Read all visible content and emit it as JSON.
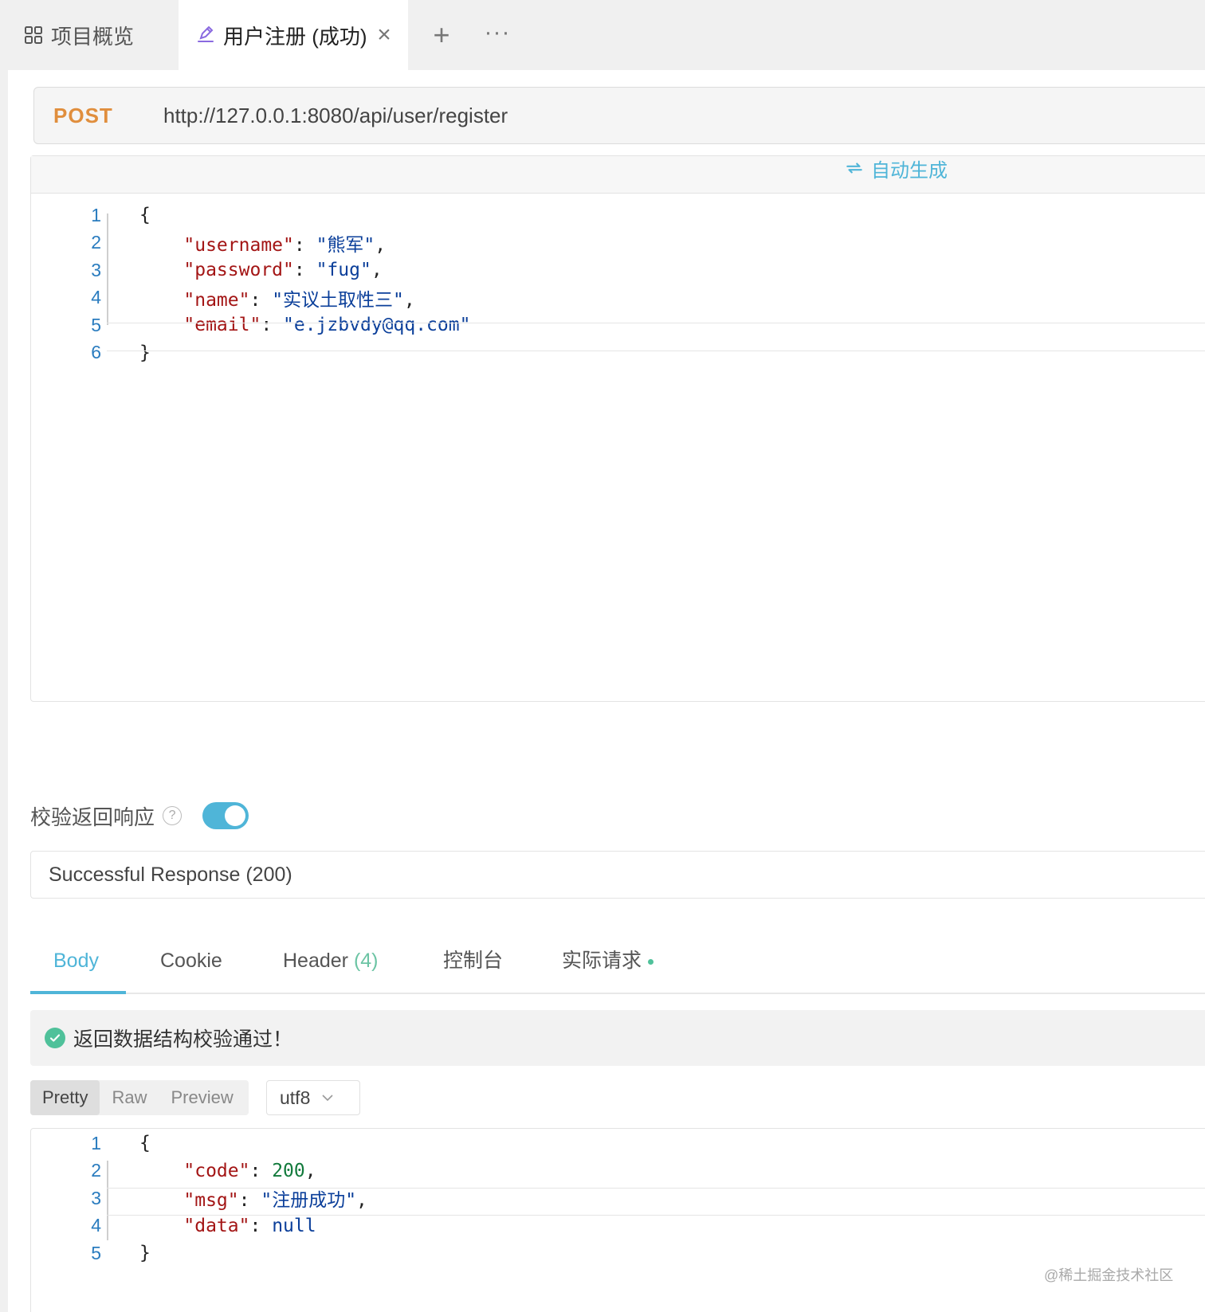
{
  "tabs": {
    "overview_label": "项目概览",
    "active_label": "用户注册 (成功)"
  },
  "request": {
    "method": "POST",
    "url": "http://127.0.0.1:8080/api/user/register",
    "auto_generate_label": "自动生成",
    "body_lines": [
      {
        "no": "1",
        "parts": [
          {
            "t": "p",
            "v": "{"
          }
        ]
      },
      {
        "no": "2",
        "parts": [
          {
            "t": "p",
            "v": "    "
          },
          {
            "t": "k",
            "v": "\"username\""
          },
          {
            "t": "p",
            "v": ": "
          },
          {
            "t": "s",
            "v": "\"熊军\""
          },
          {
            "t": "p",
            "v": ","
          }
        ]
      },
      {
        "no": "3",
        "parts": [
          {
            "t": "p",
            "v": "    "
          },
          {
            "t": "k",
            "v": "\"password\""
          },
          {
            "t": "p",
            "v": ": "
          },
          {
            "t": "s",
            "v": "\"fug\""
          },
          {
            "t": "p",
            "v": ","
          }
        ]
      },
      {
        "no": "4",
        "parts": [
          {
            "t": "p",
            "v": "    "
          },
          {
            "t": "k",
            "v": "\"name\""
          },
          {
            "t": "p",
            "v": ": "
          },
          {
            "t": "s",
            "v": "\"实议土取性三\""
          },
          {
            "t": "p",
            "v": ","
          }
        ]
      },
      {
        "no": "5",
        "parts": [
          {
            "t": "p",
            "v": "    "
          },
          {
            "t": "k",
            "v": "\"email\""
          },
          {
            "t": "p",
            "v": ": "
          },
          {
            "t": "s",
            "v": "\"e.jzbvdy@qq.com\""
          }
        ]
      },
      {
        "no": "6",
        "parts": [
          {
            "t": "p",
            "v": "}"
          }
        ]
      }
    ]
  },
  "validate": {
    "label": "校验返回响应",
    "enabled": true
  },
  "response": {
    "selected": "Successful Response (200)",
    "tabs": {
      "body": "Body",
      "cookie": "Cookie",
      "header": "Header",
      "header_count": "(4)",
      "console": "控制台",
      "actual_request": "实际请求"
    },
    "banner": "返回数据结构校验通过！",
    "view_modes": {
      "pretty": "Pretty",
      "raw": "Raw",
      "preview": "Preview"
    },
    "encoding": "utf8",
    "body_lines": [
      {
        "no": "1",
        "parts": [
          {
            "t": "p",
            "v": "{"
          }
        ]
      },
      {
        "no": "2",
        "parts": [
          {
            "t": "p",
            "v": "    "
          },
          {
            "t": "k",
            "v": "\"code\""
          },
          {
            "t": "p",
            "v": ": "
          },
          {
            "t": "n",
            "v": "200"
          },
          {
            "t": "p",
            "v": ","
          }
        ]
      },
      {
        "no": "3",
        "parts": [
          {
            "t": "p",
            "v": "    "
          },
          {
            "t": "k",
            "v": "\"msg\""
          },
          {
            "t": "p",
            "v": ": "
          },
          {
            "t": "s",
            "v": "\"注册成功\""
          },
          {
            "t": "p",
            "v": ","
          }
        ]
      },
      {
        "no": "4",
        "parts": [
          {
            "t": "p",
            "v": "    "
          },
          {
            "t": "k",
            "v": "\"data\""
          },
          {
            "t": "p",
            "v": ": "
          },
          {
            "t": "nl",
            "v": "null"
          }
        ]
      },
      {
        "no": "5",
        "parts": [
          {
            "t": "p",
            "v": "}"
          }
        ]
      }
    ]
  },
  "watermark": "@稀土掘金技术社区",
  "colors": {
    "accent": "#4fb5d8",
    "method": "#e08e3d",
    "json_key": "#a31515",
    "json_string": "#0b3f9a",
    "json_number": "#127a3c",
    "success": "#4fc19a"
  },
  "icons": {
    "overview": "grid-icon",
    "active_tab": "api-edit-icon",
    "close": "close-icon",
    "add": "plus-icon",
    "more": "more-icon",
    "autogen": "refresh-icon",
    "help": "question-icon",
    "check": "check-circle-icon",
    "encoding": "chevron-down-icon"
  }
}
